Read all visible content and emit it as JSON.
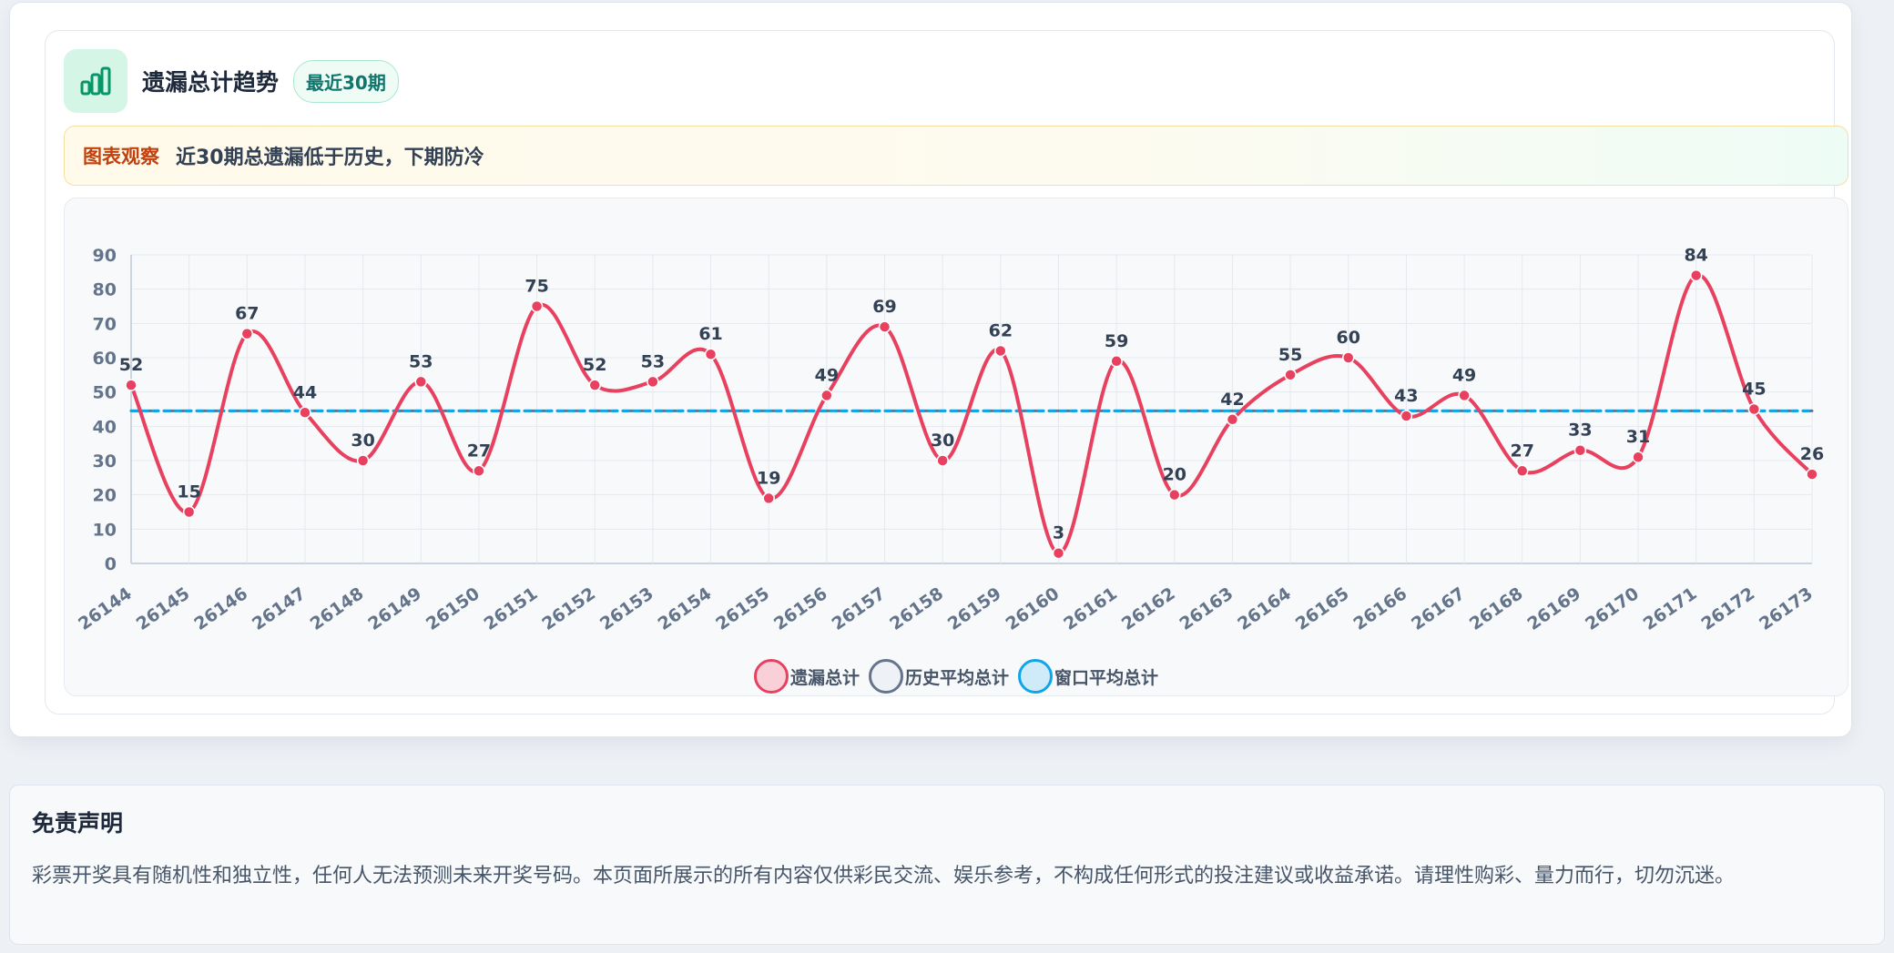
{
  "header": {
    "title": "遗漏总计趋势",
    "badge": "最近30期",
    "icon": "bar-chart-icon",
    "accent": "#059669"
  },
  "observation": {
    "tag": "图表观察",
    "text": "近30期总遗漏低于历史，下期防冷"
  },
  "chart_data": {
    "type": "line",
    "categories": [
      "26144",
      "26145",
      "26146",
      "26147",
      "26148",
      "26149",
      "26150",
      "26151",
      "26152",
      "26153",
      "26154",
      "26155",
      "26156",
      "26157",
      "26158",
      "26159",
      "26160",
      "26161",
      "26162",
      "26163",
      "26164",
      "26165",
      "26166",
      "26167",
      "26168",
      "26169",
      "26170",
      "26171",
      "26172",
      "26173"
    ],
    "series": [
      {
        "name": "遗漏总计",
        "values": [
          52,
          15,
          67,
          44,
          30,
          53,
          27,
          75,
          52,
          53,
          61,
          19,
          49,
          69,
          30,
          62,
          3,
          59,
          20,
          42,
          55,
          60,
          43,
          49,
          27,
          33,
          31,
          84,
          45,
          26
        ],
        "color": "#e8415f",
        "style": "smooth-solid",
        "fill": "#f9d0d8"
      },
      {
        "name": "历史平均总计",
        "values": [
          44.5,
          44.5,
          44.5,
          44.5,
          44.5,
          44.5,
          44.5,
          44.5,
          44.5,
          44.5,
          44.5,
          44.5,
          44.5,
          44.5,
          44.5,
          44.5,
          44.5,
          44.5,
          44.5,
          44.5,
          44.5,
          44.5,
          44.5,
          44.5,
          44.5,
          44.5,
          44.5,
          44.5,
          44.5,
          44.5
        ],
        "color": "#64748b",
        "style": "dashed",
        "fill": "#eef1f5"
      },
      {
        "name": "窗口平均总计",
        "values": [
          44.5,
          44.5,
          44.5,
          44.5,
          44.5,
          44.5,
          44.5,
          44.5,
          44.5,
          44.5,
          44.5,
          44.5,
          44.5,
          44.5,
          44.5,
          44.5,
          44.5,
          44.5,
          44.5,
          44.5,
          44.5,
          44.5,
          44.5,
          44.5,
          44.5,
          44.5,
          44.5,
          44.5,
          44.5,
          44.5
        ],
        "color": "#0ea5e9",
        "style": "dashed",
        "fill": "#cfeaf8"
      }
    ],
    "ylim": [
      0,
      90
    ],
    "yticks": [
      0,
      10,
      20,
      30,
      40,
      50,
      60,
      70,
      80,
      90
    ],
    "grid": true,
    "legend": "bottom-center",
    "data_labels": true
  },
  "disclaimer": {
    "title": "免责声明",
    "text": "彩票开奖具有随机性和独立性，任何人无法预测未来开奖号码。本页面所展示的所有内容仅供彩民交流、娱乐参考，不构成任何形式的投注建议或收益承诺。请理性购彩、量力而行，切勿沉迷。"
  }
}
